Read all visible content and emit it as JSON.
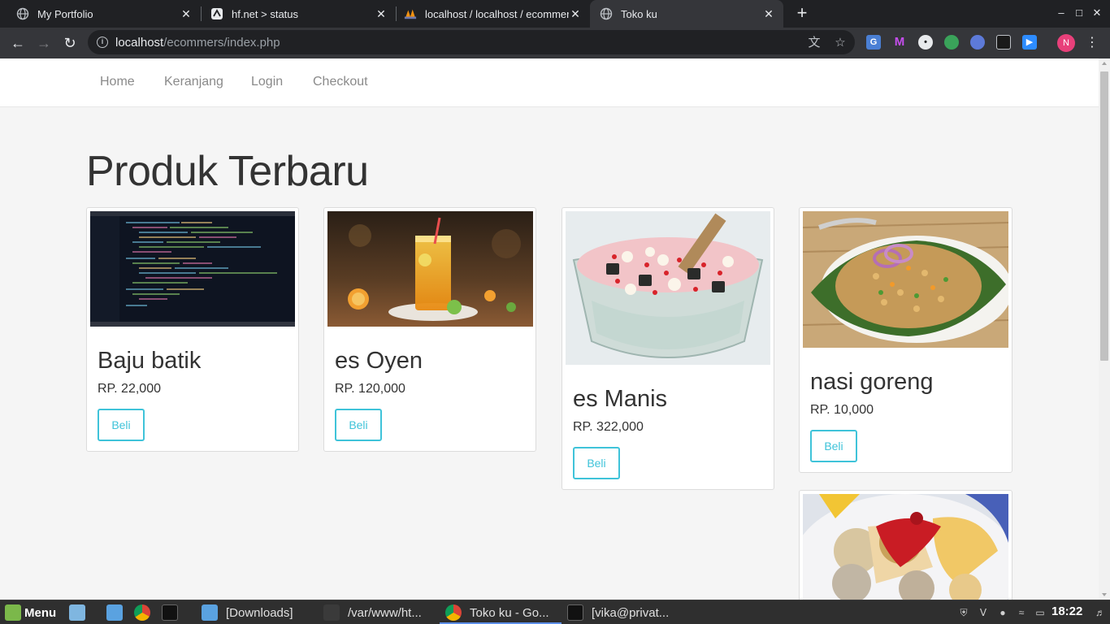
{
  "browser": {
    "tabs": [
      {
        "title": "My Portfolio",
        "icon": "globe-icon",
        "active": false
      },
      {
        "title": "hf.net > status",
        "icon": "hf-icon",
        "active": false
      },
      {
        "title": "localhost / localhost / ecommers",
        "icon": "phpmyadmin-icon",
        "active": false
      },
      {
        "title": "Toko ku",
        "icon": "globe-icon",
        "active": true
      }
    ],
    "address": {
      "host": "localhost",
      "path": "/ecommers/index.php"
    },
    "profile_initial": "N"
  },
  "site": {
    "nav": [
      {
        "label": "Home"
      },
      {
        "label": "Keranjang"
      },
      {
        "label": "Login"
      },
      {
        "label": "Checkout"
      }
    ],
    "heading": "Produk Terbaru",
    "products": [
      {
        "name": "Baju batik",
        "price": "RP. 22,000",
        "button": "Beli",
        "image": "code-screenshot"
      },
      {
        "name": "es Oyen",
        "price": "RP. 120,000",
        "button": "Beli",
        "image": "orange-drink"
      },
      {
        "name": "es Manis",
        "price": "RP. 322,000",
        "button": "Beli",
        "image": "sweet-ice-bowl"
      },
      {
        "name": "nasi goreng",
        "price": "RP. 10,000",
        "button": "Beli",
        "image": "fried-rice"
      }
    ],
    "accent": "#3fc3d9"
  },
  "taskbar": {
    "menu_label": "Menu",
    "windows": [
      {
        "label": "[Downloads]"
      },
      {
        "label": "/var/www/ht..."
      },
      {
        "label": "Toko ku - Go..."
      },
      {
        "label": "[vika@privat..."
      }
    ],
    "clock": "18:22"
  }
}
